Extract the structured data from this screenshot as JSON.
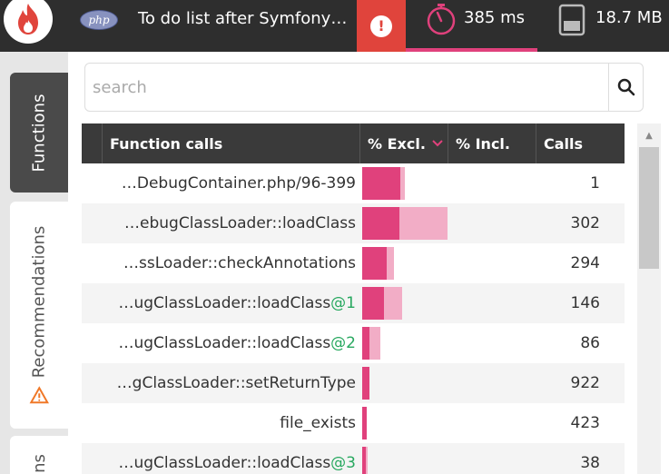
{
  "topbar": {
    "php_badge": "php",
    "title": "To do list after Symfony…",
    "alert_symbol": "!",
    "time": "385 ms",
    "memory": "18.7 MB"
  },
  "tabs": {
    "functions": "Functions",
    "recommendations": "Recommendations",
    "third": "ns"
  },
  "search": {
    "placeholder": "search"
  },
  "table": {
    "headers": {
      "function_calls": "Function calls",
      "excl": "% Excl.",
      "incl": "% Incl.",
      "calls": "Calls"
    },
    "rows": [
      {
        "name": "…DebugContainer.php/96-399",
        "suffix": "",
        "calls": "1",
        "excl_pct": 45,
        "incl_pct": 50
      },
      {
        "name": "…ebugClassLoader::loadClass",
        "suffix": "",
        "calls": "302",
        "excl_pct": 44,
        "incl_pct": 100
      },
      {
        "name": "…ssLoader::checkAnnotations",
        "suffix": "",
        "calls": "294",
        "excl_pct": 29,
        "incl_pct": 37
      },
      {
        "name": "…ugClassLoader::loadClass",
        "suffix": "@1",
        "calls": "146",
        "excl_pct": 26,
        "incl_pct": 47
      },
      {
        "name": "…ugClassLoader::loadClass",
        "suffix": "@2",
        "calls": "86",
        "excl_pct": 8,
        "incl_pct": 21
      },
      {
        "name": "…gClassLoader::setReturnType",
        "suffix": "",
        "calls": "922",
        "excl_pct": 8,
        "incl_pct": 8
      },
      {
        "name": "file_exists",
        "suffix": "",
        "calls": "423",
        "excl_pct": 5,
        "incl_pct": 5
      },
      {
        "name": "…ugClassLoader::loadClass",
        "suffix": "@3",
        "calls": "38",
        "excl_pct": 4,
        "incl_pct": 6
      }
    ]
  },
  "colors": {
    "accent": "#e0417c",
    "incl": "#f2adc6",
    "alert": "#e0443c",
    "suffix": "#27a85f"
  }
}
